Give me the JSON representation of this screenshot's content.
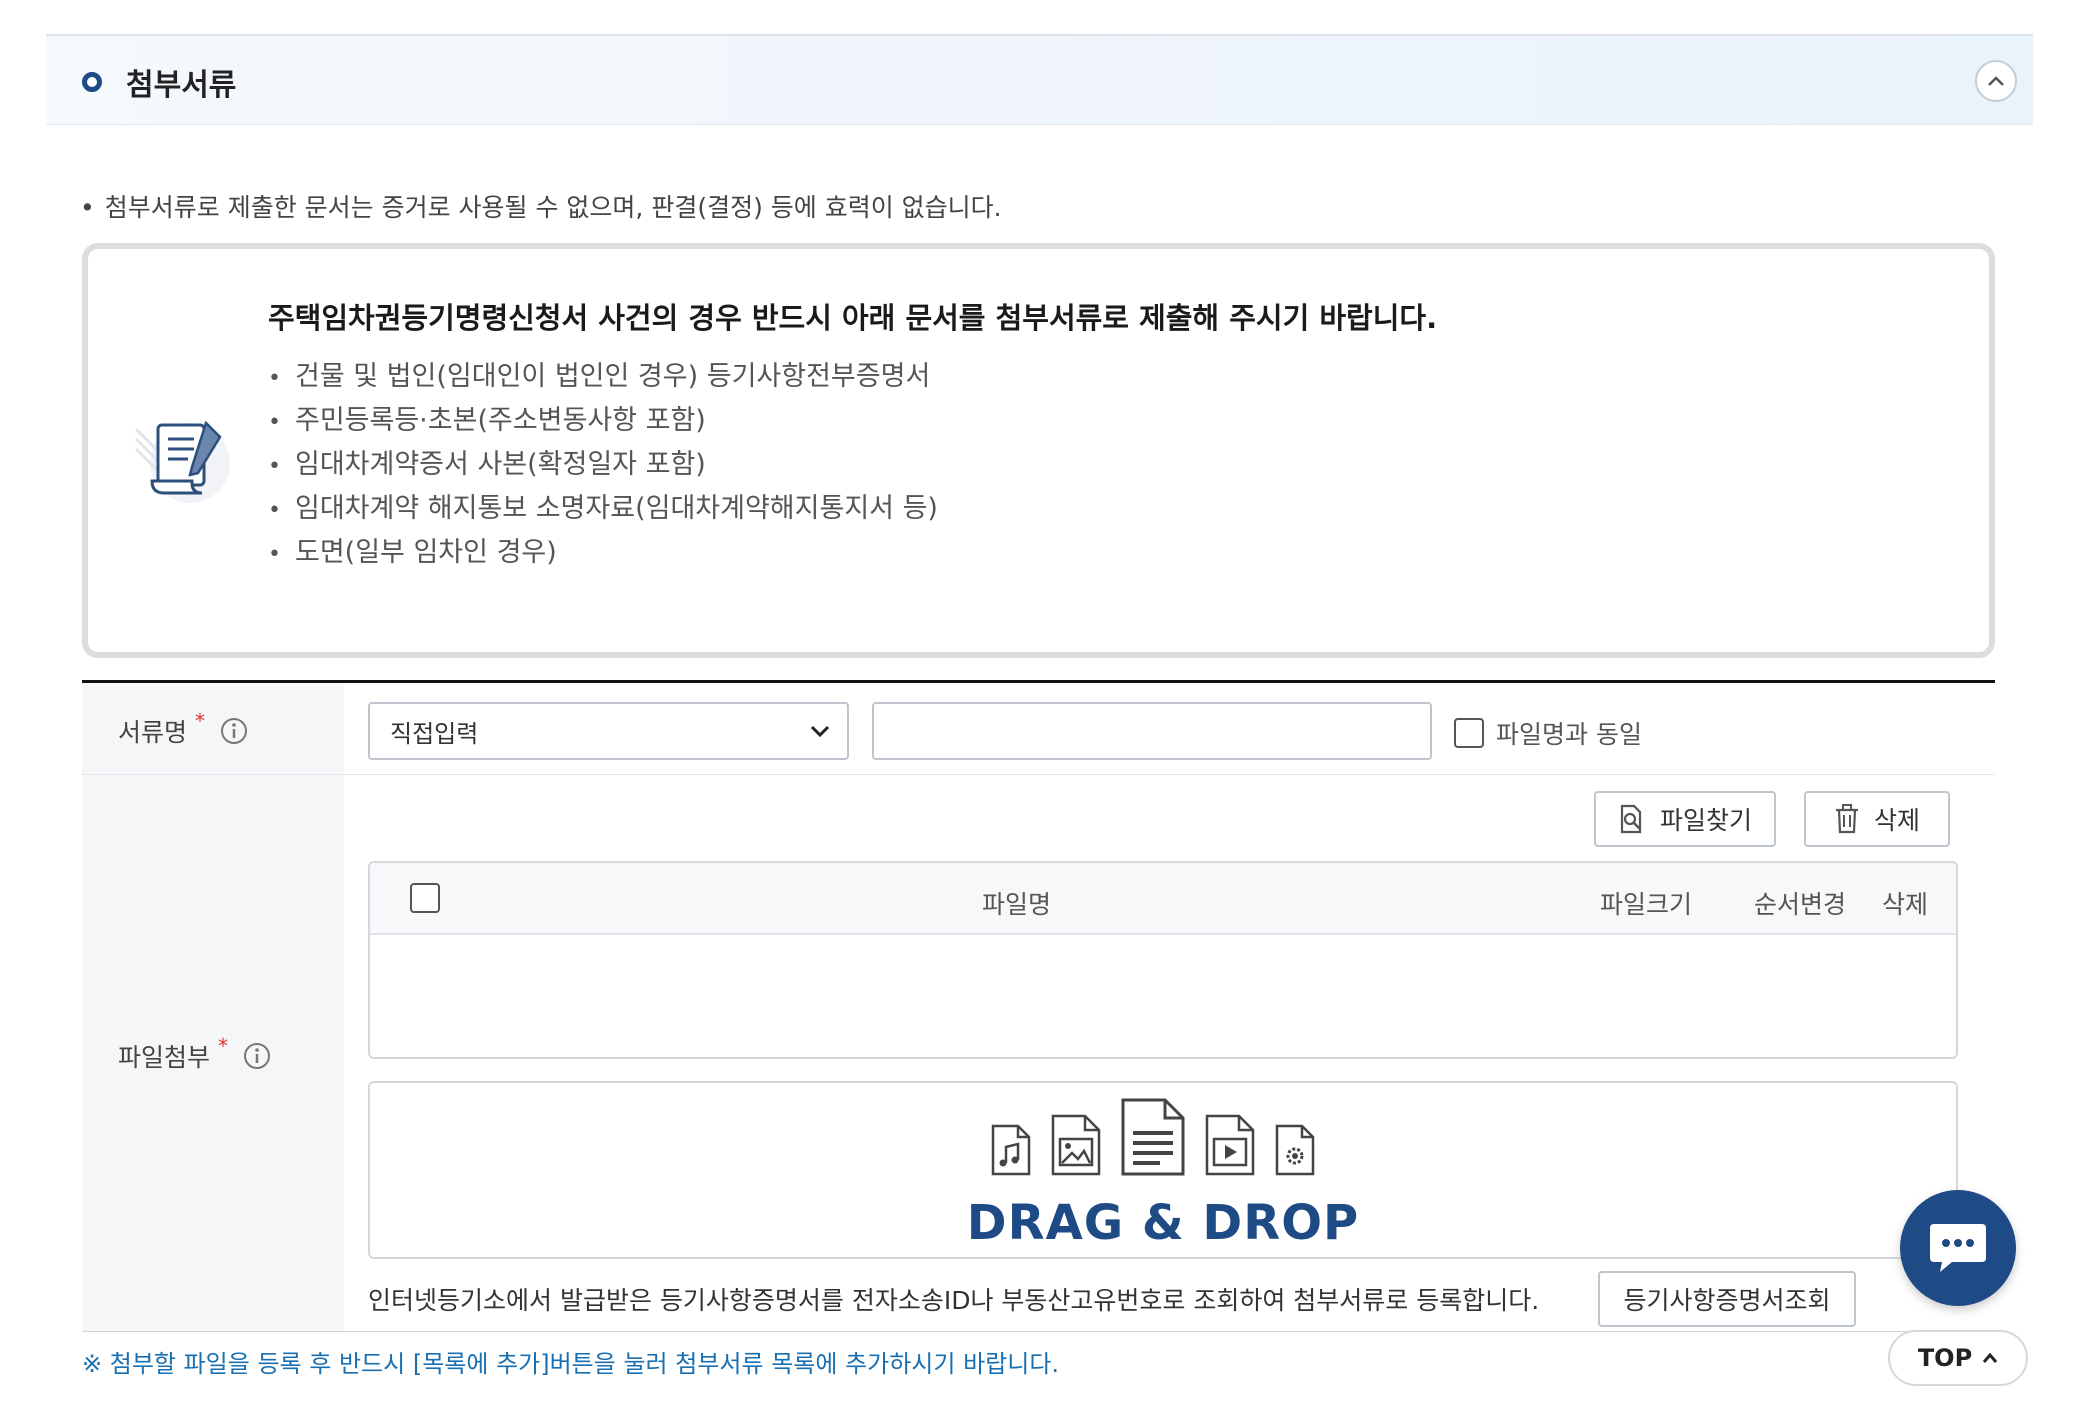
{
  "section": {
    "title": "첨부서류"
  },
  "notice": "첨부서류로 제출한 문서는 증거로 사용될 수 없으며, 판결(결정) 등에 효력이 없습니다.",
  "guide": {
    "title": "주택임차권등기명령신청서 사건의 경우 반드시 아래 문서를 첨부서류로 제출해 주시기 바랍니다.",
    "items": [
      "건물 및 법인(임대인이 법인인 경우) 등기사항전부증명서",
      "주민등록등·초본(주소변동사항 포함)",
      "임대차계약증서 사본(확정일자 포함)",
      "임대차계약 해지통보 소명자료(임대차계약해지통지서 등)",
      "도면(일부 임차인 경우)"
    ]
  },
  "form": {
    "doc_name_label": "서류명",
    "doc_name_required": "*",
    "doc_type_selected": "직접입력",
    "doc_name_value": "",
    "same_as_filename_label": "파일명과 동일",
    "attach_label": "파일첨부",
    "attach_required": "*",
    "find_file_button": "파일찾기",
    "delete_button": "삭제",
    "file_table_headers": {
      "name": "파일명",
      "size": "파일크기",
      "order": "순서변경",
      "delete": "삭제"
    },
    "drop_text": "DRAG & DROP",
    "registry_text": "인터넷등기소에서 발급받은 등기사항증명서를 전자소송ID나 부동산고유번호로 조회하여 첨부서류로 등록합니다.",
    "registry_button": "등기사항증명서조회"
  },
  "footer_note": "※ 첨부할 파일을 등록 후 반드시 [목록에 추가]버튼을 눌러 첨부서류 목록에 추가하시기 바랍니다.",
  "top_button": "TOP",
  "colors": {
    "accent": "#1e4a86",
    "note": "#1a6fb0",
    "required": "#dd3333"
  }
}
